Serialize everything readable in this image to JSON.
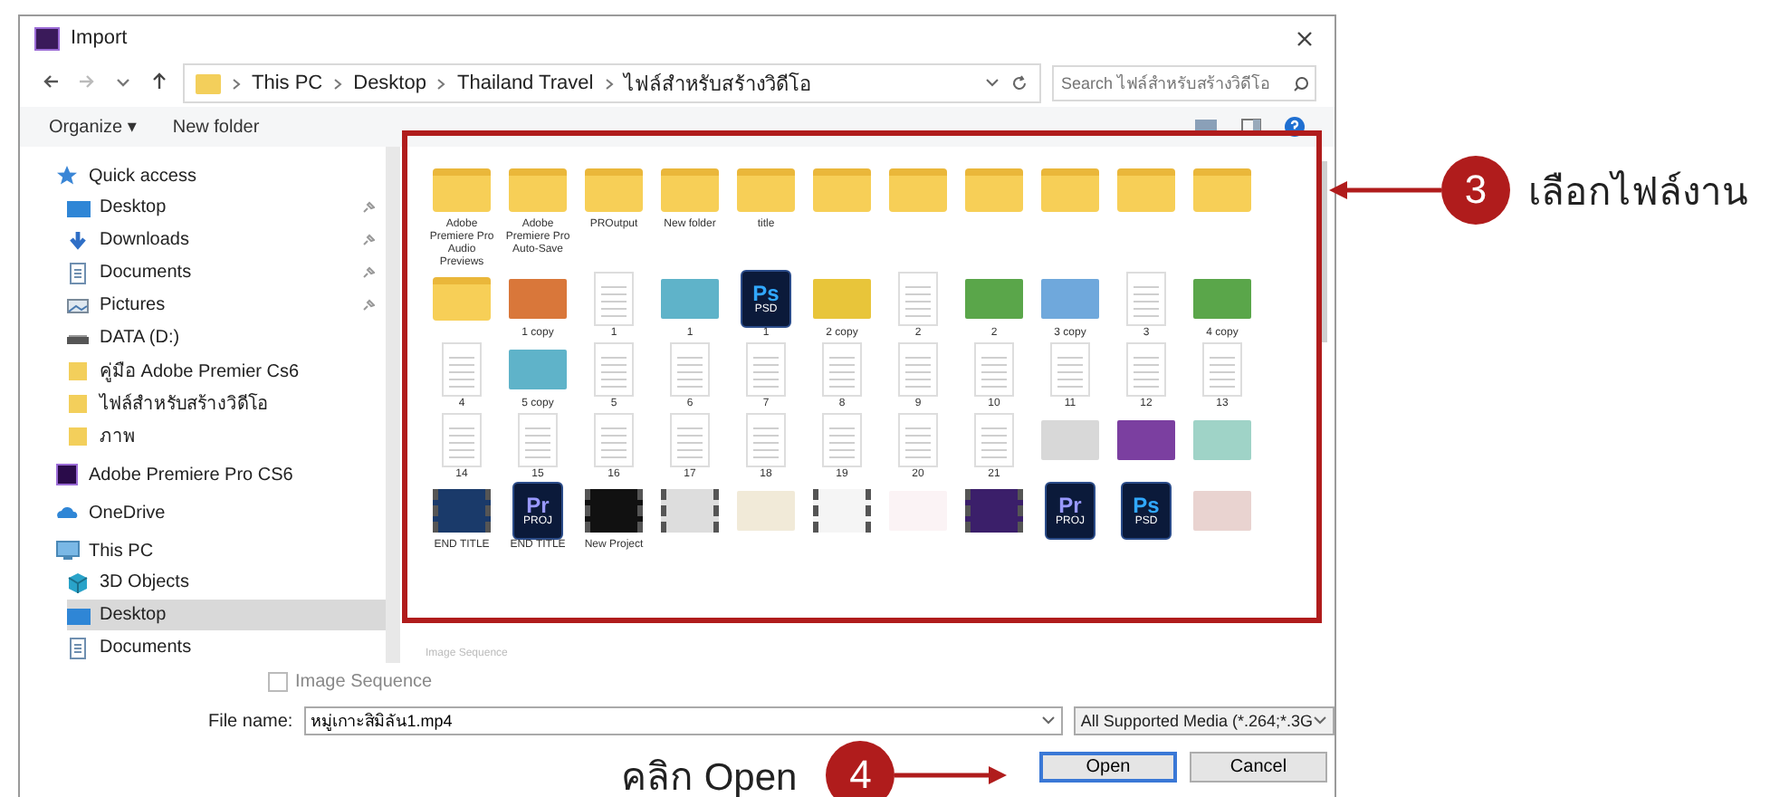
{
  "window": {
    "title": "Import"
  },
  "address_bar": {
    "crumbs": [
      "This PC",
      "Desktop",
      "Thailand Travel",
      "ไฟล์สำหรับสร้างวิดีโอ"
    ]
  },
  "search": {
    "placeholder": "Search ไฟล์สำหรับสร้างวิดีโอ"
  },
  "toolbar": {
    "organize": "Organize ▾",
    "new_folder": "New folder"
  },
  "sidebar": {
    "items": [
      {
        "kind": "star",
        "label": "Quick access",
        "selected": false,
        "children": [
          {
            "kind": "desktop",
            "label": "Desktop",
            "pinned": true,
            "selected": false
          },
          {
            "kind": "download",
            "label": "Downloads",
            "pinned": true,
            "selected": false
          },
          {
            "kind": "documents",
            "label": "Documents",
            "pinned": true,
            "selected": false
          },
          {
            "kind": "pictures",
            "label": "Pictures",
            "pinned": true,
            "selected": false
          },
          {
            "kind": "drive",
            "label": "DATA (D:)",
            "pinned": false,
            "selected": false
          },
          {
            "kind": "folder",
            "label": "คู่มือ Adobe Premier Cs6",
            "pinned": false,
            "selected": false
          },
          {
            "kind": "folder",
            "label": "ไฟล์สำหรับสร้างวิดีโอ",
            "pinned": false,
            "selected": false
          },
          {
            "kind": "folder",
            "label": "ภาพ",
            "pinned": false,
            "selected": false
          }
        ]
      },
      {
        "kind": "premiere",
        "label": "Adobe Premiere Pro CS6",
        "selected": false
      },
      {
        "kind": "cloud",
        "label": "OneDrive",
        "selected": false
      },
      {
        "kind": "pc",
        "label": "This PC",
        "selected": false,
        "children": [
          {
            "kind": "cube",
            "label": "3D Objects",
            "pinned": false,
            "selected": false
          },
          {
            "kind": "desktop",
            "label": "Desktop",
            "pinned": false,
            "selected": true
          },
          {
            "kind": "documents",
            "label": "Documents",
            "pinned": false,
            "selected": false
          }
        ]
      }
    ]
  },
  "files": [
    {
      "kind": "folder",
      "label": "Adobe Premiere Pro Audio Previews"
    },
    {
      "kind": "folder",
      "label": "Adobe Premiere Pro Auto-Save"
    },
    {
      "kind": "folder",
      "label": "PROutput"
    },
    {
      "kind": "folder",
      "label": "New folder"
    },
    {
      "kind": "folder",
      "label": "title"
    },
    {
      "kind": "folder"
    },
    {
      "kind": "folder"
    },
    {
      "kind": "folder"
    },
    {
      "kind": "folder"
    },
    {
      "kind": "folder"
    },
    {
      "kind": "folder"
    },
    {
      "kind": "folder"
    },
    {
      "kind": "image",
      "color": "#d9773a",
      "label": "1 copy"
    },
    {
      "kind": "document",
      "label": "1"
    },
    {
      "kind": "image",
      "color": "#5fb3c9",
      "label": "1"
    },
    {
      "kind": "app",
      "color": "#31a8ff",
      "glyph": "Ps",
      "tag": "PSD",
      "label": "1"
    },
    {
      "kind": "image",
      "color": "#e8c53a",
      "label": "2 copy"
    },
    {
      "kind": "document",
      "label": "2"
    },
    {
      "kind": "image",
      "color": "#5aa64a",
      "label": "2"
    },
    {
      "kind": "image",
      "color": "#6fa8dc",
      "label": "3 copy"
    },
    {
      "kind": "document",
      "label": "3"
    },
    {
      "kind": "image",
      "color": "#5aa64a",
      "label": "4 copy"
    },
    {
      "kind": "document",
      "label": "4"
    },
    {
      "kind": "image",
      "color": "#5fb3c9",
      "label": "5 copy"
    },
    {
      "kind": "document",
      "label": "5"
    },
    {
      "kind": "document",
      "label": "6"
    },
    {
      "kind": "document",
      "label": "7"
    },
    {
      "kind": "document",
      "label": "8"
    },
    {
      "kind": "document",
      "label": "9"
    },
    {
      "kind": "document",
      "label": "10"
    },
    {
      "kind": "document",
      "label": "11"
    },
    {
      "kind": "document",
      "label": "12"
    },
    {
      "kind": "document",
      "label": "13"
    },
    {
      "kind": "document",
      "label": "14"
    },
    {
      "kind": "document",
      "label": "15"
    },
    {
      "kind": "document",
      "label": "16"
    },
    {
      "kind": "document",
      "label": "17"
    },
    {
      "kind": "document",
      "label": "18"
    },
    {
      "kind": "document",
      "label": "19"
    },
    {
      "kind": "document",
      "label": "20"
    },
    {
      "kind": "document",
      "label": "21"
    },
    {
      "kind": "image",
      "color": "#d8d8d8"
    },
    {
      "kind": "image",
      "color": "#7b3fa0"
    },
    {
      "kind": "image",
      "color": "#9fd3c7"
    },
    {
      "kind": "video",
      "color": "#1a3a6a",
      "label": "END TITLE"
    },
    {
      "kind": "app",
      "color": "#9999ff",
      "glyph": "Pr",
      "tag": "PROJ",
      "label": "END TITLE"
    },
    {
      "kind": "video",
      "color": "#111111",
      "label": "New Project"
    },
    {
      "kind": "video",
      "color": "#dddddd"
    },
    {
      "kind": "image",
      "color": "#f1ead8"
    },
    {
      "kind": "video",
      "color": "#f5f5f5"
    },
    {
      "kind": "image",
      "color": "#fbf3f5"
    },
    {
      "kind": "video",
      "color": "#3b1f6a"
    },
    {
      "kind": "app",
      "color": "#9999ff",
      "glyph": "Pr",
      "tag": "PROJ"
    },
    {
      "kind": "app",
      "color": "#31a8ff",
      "glyph": "Ps",
      "tag": "PSD"
    },
    {
      "kind": "image",
      "color": "#e9d3d0"
    }
  ],
  "pane_footer": "Image Sequence",
  "image_sequence": {
    "label": "Image Sequence",
    "checked": false
  },
  "file_name": {
    "label": "File name:",
    "value": "หมู่เกาะสิมิลัน1.mp4"
  },
  "file_type": {
    "value": "All Supported Media (*.264;*.3G"
  },
  "buttons": [
    {
      "label": "Open",
      "selected": true
    },
    {
      "label": "Cancel",
      "selected": false
    }
  ],
  "annotations": [
    {
      "kind": "step",
      "number": "3",
      "text": "เลือกไฟล์งาน"
    },
    {
      "kind": "step",
      "number": "4",
      "text": "คลิก Open"
    }
  ]
}
